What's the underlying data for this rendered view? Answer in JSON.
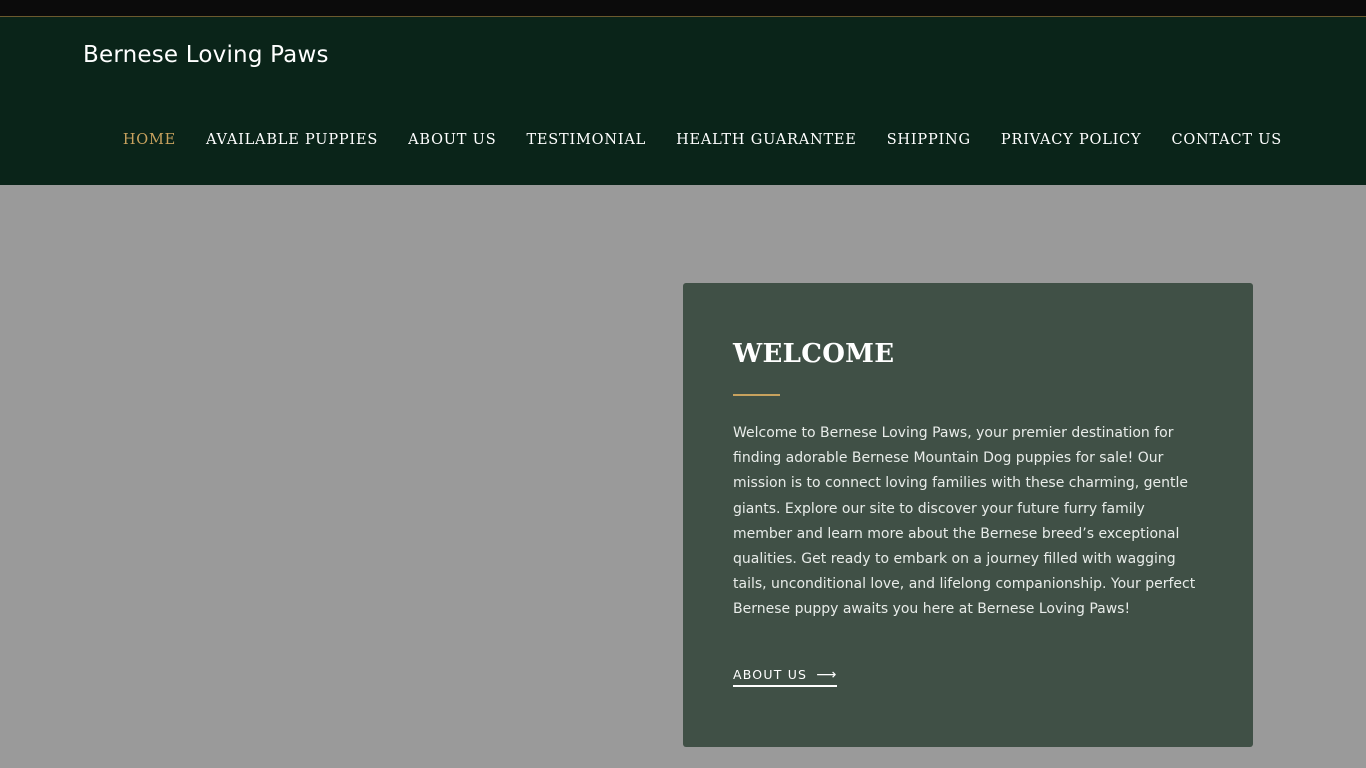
{
  "site": {
    "title": "Bernese Loving Paws"
  },
  "nav": {
    "items": [
      {
        "label": "HOME",
        "active": true
      },
      {
        "label": "AVAILABLE PUPPIES",
        "active": false
      },
      {
        "label": "ABOUT US",
        "active": false
      },
      {
        "label": "TESTIMONIAL",
        "active": false
      },
      {
        "label": "HEALTH GUARANTEE",
        "active": false
      },
      {
        "label": "SHIPPING",
        "active": false
      },
      {
        "label": "PRIVACY POLICY",
        "active": false
      },
      {
        "label": "CONTACT US",
        "active": false
      }
    ]
  },
  "welcome": {
    "heading": "WELCOME",
    "body": "Welcome to Bernese Loving Paws, your premier destination for finding adorable Bernese Mountain Dog puppies for sale! Our mission is to connect loving families with these charming, gentle giants. Explore our site to discover your future furry family member and learn more about the Bernese breed’s exceptional qualities. Get ready to embark on a journey filled with wagging tails, unconditional love, and lifelong companionship. Your perfect Bernese puppy awaits you here at Bernese Loving Paws!",
    "link_label": "ABOUT US",
    "link_icon": "arrow-right-icon"
  },
  "colors": {
    "header_bg": "#0a2419",
    "accent_gold": "#c8a25e",
    "card_bg": "#405046",
    "page_bg": "#9a9a9a"
  }
}
